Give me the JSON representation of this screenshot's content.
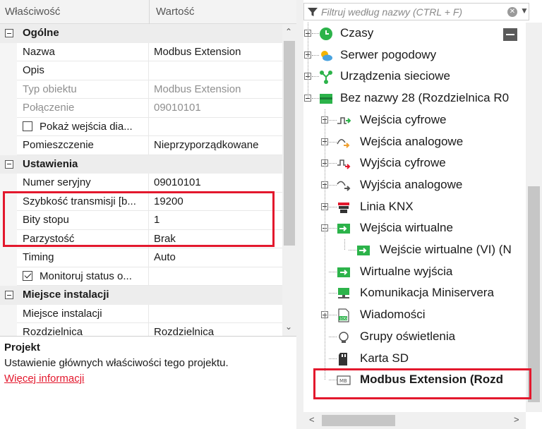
{
  "properties": {
    "header": {
      "name_col": "Właściwość",
      "value_col": "Wartość"
    },
    "rows": [
      {
        "kind": "category",
        "label": "Ogólne"
      },
      {
        "kind": "prop",
        "label": "Nazwa",
        "value": "Modbus Extension"
      },
      {
        "kind": "prop",
        "label": "Opis",
        "value": ""
      },
      {
        "kind": "prop",
        "label": "Typ obiektu",
        "value": "Modbus Extension",
        "disabled": true
      },
      {
        "kind": "prop",
        "label": "Połączenie",
        "value": "09010101",
        "disabled": true
      },
      {
        "kind": "check",
        "label": "Pokaż wejścia dia...",
        "checked": false
      },
      {
        "kind": "prop",
        "label": "Pomieszczenie",
        "value": "Nieprzyporządkowane"
      },
      {
        "kind": "category",
        "label": "Ustawienia"
      },
      {
        "kind": "prop",
        "label": "Numer seryjny",
        "value": "09010101"
      },
      {
        "kind": "prop",
        "label": "Szybkość transmisji [b...",
        "value": "19200"
      },
      {
        "kind": "prop",
        "label": "Bity stopu",
        "value": "1"
      },
      {
        "kind": "prop",
        "label": "Parzystość",
        "value": "Brak"
      },
      {
        "kind": "prop",
        "label": "Timing",
        "value": "Auto"
      },
      {
        "kind": "check",
        "label": "Monitoruj status o...",
        "checked": true
      },
      {
        "kind": "category",
        "label": "Miejsce instalacji"
      },
      {
        "kind": "prop",
        "label": "Miejsce instalacji",
        "value": ""
      },
      {
        "kind": "prop",
        "label": "Rozdzielnica",
        "value": "Rozdzielnica"
      }
    ],
    "description": {
      "title": "Projekt",
      "text": "Ustawienie głównych właściwości tego projektu.",
      "link": "Więcej informacji"
    }
  },
  "tree": {
    "search_placeholder": "Filtruj według nazwy (CTRL + F)",
    "items": [
      {
        "label": "Czasy",
        "icon": "clock-icon",
        "level": 0,
        "expander": "plus"
      },
      {
        "label": "Serwer pogodowy",
        "icon": "weather-icon",
        "level": 0,
        "expander": "plus"
      },
      {
        "label": "Urządzenia sieciowe",
        "icon": "network-devices-icon",
        "level": 0,
        "expander": "plus"
      },
      {
        "label": "Bez nazwy 28 (Rozdzielnica R0",
        "icon": "miniserver-icon",
        "level": 0,
        "expander": "minus"
      },
      {
        "label": "Wejścia cyfrowe",
        "icon": "digital-input-icon",
        "level": 1,
        "expander": "plus"
      },
      {
        "label": "Wejścia analogowe",
        "icon": "analog-input-icon",
        "level": 1,
        "expander": "plus"
      },
      {
        "label": "Wyjścia cyfrowe",
        "icon": "digital-output-icon",
        "level": 1,
        "expander": "plus"
      },
      {
        "label": "Wyjścia analogowe",
        "icon": "analog-output-icon",
        "level": 1,
        "expander": "plus"
      },
      {
        "label": "Linia KNX",
        "icon": "knx-icon",
        "level": 1,
        "expander": "plus"
      },
      {
        "label": "Wejścia wirtualne",
        "icon": "virtual-input-icon",
        "level": 1,
        "expander": "minus"
      },
      {
        "label": "Wejście wirtualne (VI) (N",
        "icon": "virtual-input-icon",
        "level": 2,
        "expander": "none"
      },
      {
        "label": "Wirtualne wyjścia",
        "icon": "virtual-output-icon",
        "level": 1,
        "expander": "none"
      },
      {
        "label": "Komunikacja Miniservera",
        "icon": "network-icon",
        "level": 1,
        "expander": "none"
      },
      {
        "label": "Wiadomości",
        "icon": "log-icon",
        "level": 1,
        "expander": "plus"
      },
      {
        "label": "Grupy oświetlenia",
        "icon": "lighting-group-icon",
        "level": 1,
        "expander": "none"
      },
      {
        "label": "Karta SD",
        "icon": "sd-card-icon",
        "level": 1,
        "expander": "none"
      },
      {
        "label": "Modbus Extension (Rozd",
        "icon": "modbus-icon",
        "level": 1,
        "expander": "none",
        "bold": true
      }
    ]
  },
  "colors": {
    "accent_red": "#e3182d",
    "green": "#2cb34a"
  }
}
